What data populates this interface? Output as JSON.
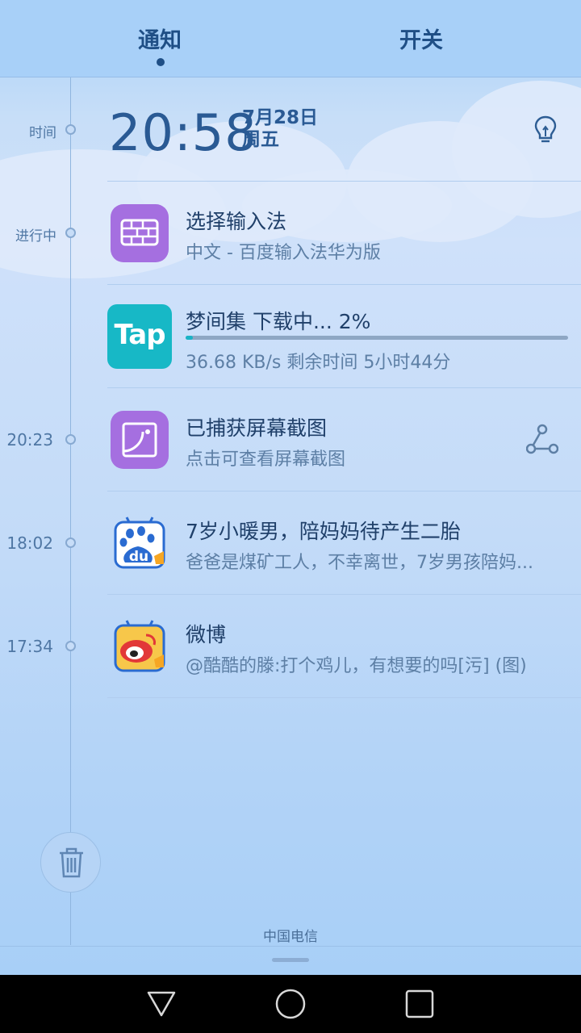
{
  "tabs": {
    "notify": "通知",
    "switches": "开关"
  },
  "timeline": {
    "time_label": "时间",
    "ongoing_label": "进行中",
    "t1": "20:23",
    "t2": "18:02",
    "t3": "17:34"
  },
  "header": {
    "clock": "20:58",
    "date": "7月28日",
    "weekday": "周五"
  },
  "notifications": [
    {
      "title": "选择输入法",
      "subtitle": "中文 - 百度输入法华为版",
      "icon": "keyboard-icon"
    },
    {
      "title": "梦间集 下载中... 2%",
      "subtitle": "36.68 KB/s  剩余时间 5小时44分",
      "icon": "tap-icon",
      "icon_text": "Tap",
      "progress": 0.02
    },
    {
      "title": "已捕获屏幕截图",
      "subtitle": "点击可查看屏幕截图",
      "icon": "screenshot-icon"
    },
    {
      "title": "7岁小暖男，陪妈妈待产生二胎",
      "subtitle": "爸爸是煤矿工人，不幸离世，7岁男孩陪妈...",
      "icon": "baidu-icon",
      "icon_text": "du"
    },
    {
      "title": "微博",
      "subtitle": "@酷酷的滕:打个鸡儿，有想要的吗[污] (图)",
      "icon": "weibo-icon"
    }
  ],
  "footer": {
    "carrier": "中国电信"
  },
  "colors": {
    "accent": "#1ab3c6",
    "purple": "#a56fe0",
    "text": "#20406a"
  }
}
